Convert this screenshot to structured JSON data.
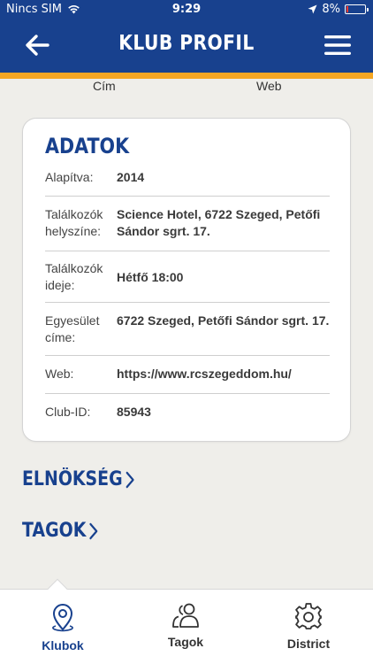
{
  "status_bar": {
    "carrier": "Nincs SIM",
    "time": "9:29",
    "battery": "8%"
  },
  "header": {
    "title": "KLUB PROFIL"
  },
  "subtabs": [
    "Cím",
    "Web"
  ],
  "card": {
    "title": "ADATOK",
    "rows": [
      {
        "label": "Alapítva:",
        "value": "2014"
      },
      {
        "label": "Találkozók helyszíne:",
        "value": "Science Hotel, 6722 Szeged, Petőfi Sándor sgrt. 17."
      },
      {
        "label": "Találkozók ideje:",
        "value": "Hétfő 18:00"
      },
      {
        "label": "Egyesület címe:",
        "value": "6722 Szeged, Petőfi Sándor sgrt. 17."
      },
      {
        "label": "Web:",
        "value": "https://www.rcszegeddom.hu/"
      },
      {
        "label": "Club-ID:",
        "value": "85943"
      }
    ]
  },
  "sections": {
    "board": "ELNÖKSÉG",
    "members": "TAGOK"
  },
  "tab_bar": {
    "items": [
      {
        "label": "Klubok",
        "icon": "location-pin-icon",
        "active": true
      },
      {
        "label": "Tagok",
        "icon": "people-icon",
        "active": false
      },
      {
        "label": "District",
        "icon": "gear-icon",
        "active": false
      }
    ]
  },
  "colors": {
    "primary": "#18418e",
    "accent": "#f5a623",
    "background": "#efeeea"
  }
}
